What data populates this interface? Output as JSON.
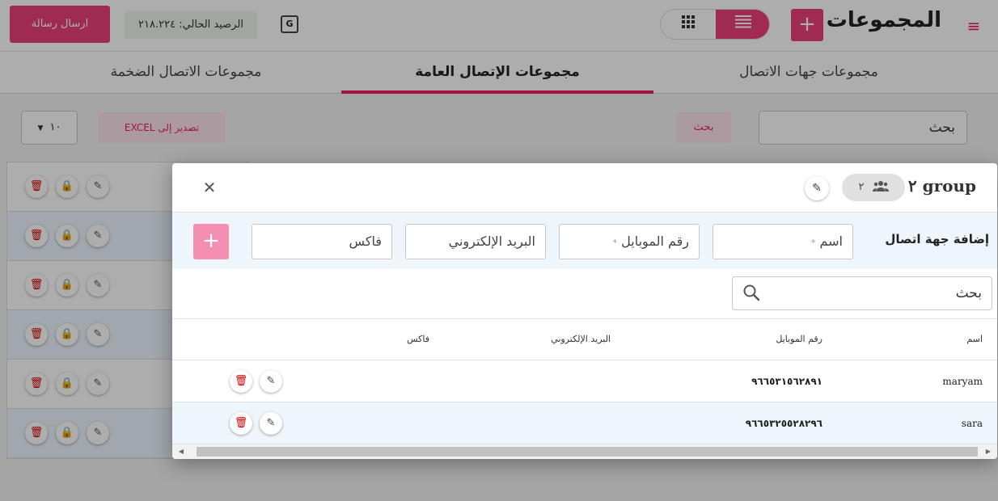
{
  "header": {
    "title": "المجموعات",
    "add_icon": "+",
    "menu_icon": "≡",
    "balance": "الرصيد الحالي: ٢١٨.٢٢٤",
    "send_button": "ارسال رسالة",
    "translate_icon": "G"
  },
  "tabs": {
    "contact_groups": "مجموعات جهات الاتصال",
    "public_groups": "مجموعات الإتصال العامة",
    "bulk_groups": "مجموعات الاتصال الضخمة"
  },
  "toolbar": {
    "search_value": "بحث",
    "search_button": "بحث",
    "export_button": "تصدير إلى EXCEL",
    "page_size": "١٠"
  },
  "modal": {
    "title": "group ٢",
    "member_count": "٢",
    "add_contact_label": "إضافة جهة اتصال",
    "name_placeholder": "اسم",
    "mobile_placeholder": "رقم الموبايل",
    "email_placeholder": "البريد الإلكتروني",
    "fax_placeholder": "فاكس",
    "required_mark": "*",
    "add_button": "+",
    "close_icon": "✕",
    "search_value": "بحث",
    "columns": {
      "name": "اسم",
      "mobile": "رقم الموبايل",
      "email": "البريد الإلكتروني",
      "fax": "فاكس"
    },
    "rows": [
      {
        "name": "maryam",
        "mobile": "٩٦٦٥٣١٥٦٢٨٩١",
        "email": "",
        "fax": ""
      },
      {
        "name": "sara",
        "mobile": "٩٦٦٥٣٢٥٥٢٨٢٩٦",
        "email": "",
        "fax": ""
      }
    ]
  },
  "colors": {
    "accent": "#e91e63",
    "accent_light": "#fce4ec",
    "delete": "#d50000",
    "lock": "#f9a825"
  }
}
